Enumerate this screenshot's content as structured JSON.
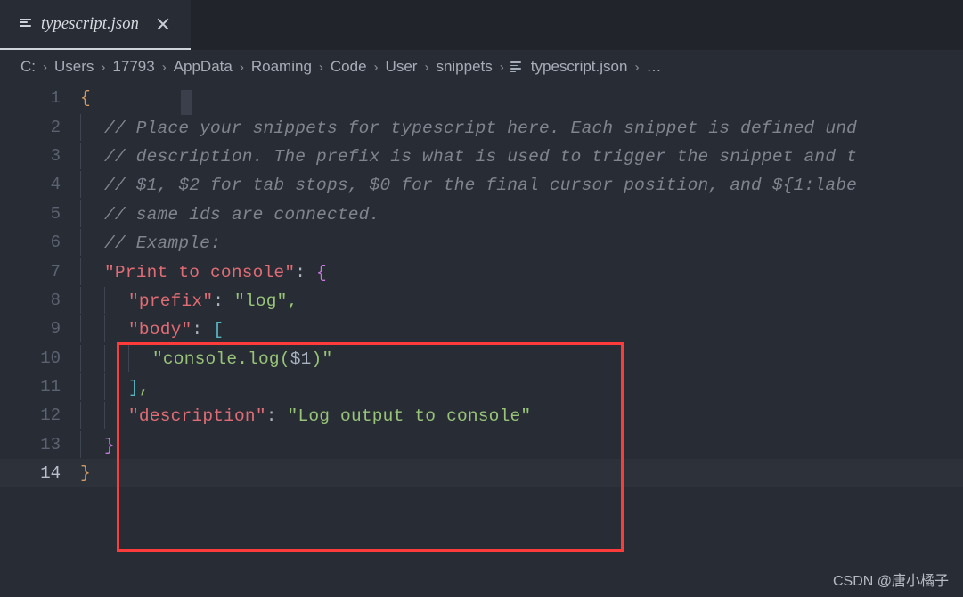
{
  "window": {
    "background": "#282c34",
    "accent": "#fc3b3b"
  },
  "tab": {
    "label": "typescript.json",
    "icon": "json-file-icon",
    "close_icon": "close-icon",
    "preview_italic": true
  },
  "breadcrumbs": {
    "separator": "›",
    "items": [
      {
        "label": "C:"
      },
      {
        "label": "Users"
      },
      {
        "label": "17793"
      },
      {
        "label": "AppData"
      },
      {
        "label": "Roaming"
      },
      {
        "label": "Code"
      },
      {
        "label": "User"
      },
      {
        "label": "snippets"
      }
    ],
    "file": {
      "label": "typescript.json",
      "icon": "json-file-icon"
    },
    "overflow": "…"
  },
  "editor": {
    "active_line": 14,
    "total_lines": 14,
    "line_numbers": [
      "1",
      "2",
      "3",
      "4",
      "5",
      "6",
      "7",
      "8",
      "9",
      "10",
      "11",
      "12",
      "13",
      "14"
    ],
    "lines": [
      {
        "n": "1",
        "text": "{"
      },
      {
        "n": "2",
        "text": "  // Place your snippets for typescript here. Each snippet is defined und"
      },
      {
        "n": "3",
        "text": "  // description. The prefix is what is used to trigger the snippet and t"
      },
      {
        "n": "4",
        "text": "  // $1, $2 for tab stops, $0 for the final cursor position, and ${1:labe"
      },
      {
        "n": "5",
        "text": "  // same ids are connected."
      },
      {
        "n": "6",
        "text": "  // Example:"
      },
      {
        "n": "7",
        "text": "  \"Print to console\": {"
      },
      {
        "n": "8",
        "text": "    \"prefix\": \"log\","
      },
      {
        "n": "9",
        "text": "    \"body\": ["
      },
      {
        "n": "10",
        "text": "      \"console.log($1)\""
      },
      {
        "n": "11",
        "text": "    ],"
      },
      {
        "n": "12",
        "text": "    \"description\": \"Log output to console\""
      },
      {
        "n": "13",
        "text": "  }"
      },
      {
        "n": "14",
        "text": "}"
      }
    ],
    "tokens": {
      "comment2": "// Place your snippets for typescript here. Each snippet is defined und",
      "comment3": "// description. The prefix is what is used to trigger the snippet and t",
      "comment4": "// $1, $2 for tab stops, $0 for the final cursor position, and ${1:labe",
      "comment5": "// same ids are connected.",
      "comment6": "// Example:",
      "brace_open_root": "{",
      "brace_close_root": "}",
      "key_print": "\"Print to console\"",
      "colon": ":",
      "brace_open_snippet": "{",
      "key_prefix": "\"prefix\"",
      "val_log": "\"log\"",
      "comma": ",",
      "key_body": "\"body\"",
      "bracket_open": "[",
      "val_console_log_pre": "\"console.log(",
      "val_console_log_var": "$1",
      "val_console_log_post": ")\"",
      "bracket_close": "]",
      "key_description": "\"description\"",
      "val_description": "\"Log output to console\"",
      "brace_close_snippet": "}"
    },
    "colors": {
      "comment": "#7f848e",
      "key": "#e06c75",
      "string": "#98c379",
      "punctuation": "#abb2bf",
      "bracket_level1": "#d19a66",
      "bracket_level2": "#c678dd",
      "bracket_level3": "#56b6c2",
      "line_number": "#5b6271",
      "line_number_active": "#b9c0cc",
      "active_line_bg": "#2c313a"
    }
  },
  "annotation": {
    "name": "red-highlight-rectangle",
    "color": "#fc3b3b",
    "covers_lines": "7-13"
  },
  "watermark": {
    "text": "CSDN @唐小橘子"
  }
}
